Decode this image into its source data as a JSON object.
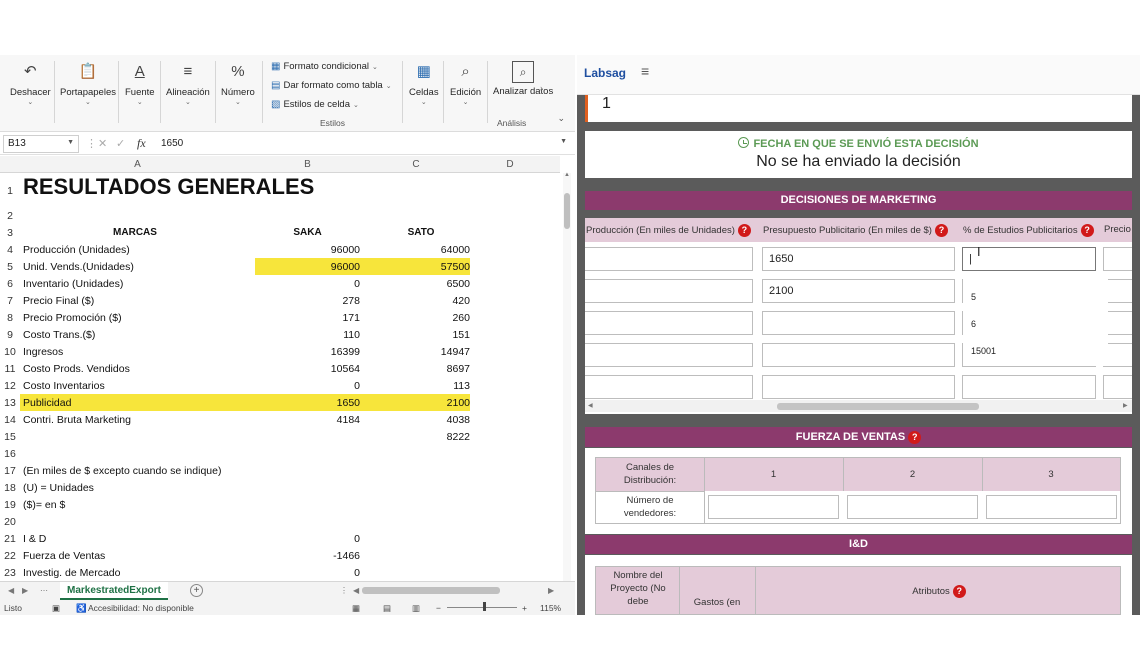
{
  "excel": {
    "ribbon": {
      "undo": "Deshacer",
      "clipboard": "Portapapeles",
      "font": "Fuente",
      "alignment": "Alineación",
      "number": "Número",
      "conditional_format": "Formato condicional",
      "format_as_table": "Dar formato como tabla",
      "cell_styles": "Estilos de celda",
      "styles_group": "Estilos",
      "cells": "Celdas",
      "editing": "Edición",
      "analyze_data": "Analizar datos",
      "analysis_group": "Análisis"
    },
    "formula_bar": {
      "name_box": "B13",
      "fx": "fx",
      "value": "1650"
    },
    "columns": [
      "A",
      "B",
      "C",
      "D"
    ],
    "rows": [
      {
        "n": "1",
        "a": "RESULTADOS GENERALES",
        "b": "",
        "c": ""
      },
      {
        "n": "2",
        "a": "",
        "b": "",
        "c": ""
      },
      {
        "n": "3",
        "a": "MARCAS",
        "b": "SAKA",
        "c": "SATO"
      },
      {
        "n": "4",
        "a": "Producción (Unidades)",
        "b": "96000",
        "c": "64000"
      },
      {
        "n": "5",
        "a": "Unid. Vends.(Unidades)",
        "b": "96000",
        "c": "57500"
      },
      {
        "n": "6",
        "a": "Inventario (Unidades)",
        "b": "0",
        "c": "6500"
      },
      {
        "n": "7",
        "a": "Precio Final ($)",
        "b": "278",
        "c": "420"
      },
      {
        "n": "8",
        "a": "Precio Promoción ($)",
        "b": "171",
        "c": "260"
      },
      {
        "n": "9",
        "a": "Costo Trans.($)",
        "b": "110",
        "c": "151"
      },
      {
        "n": "10",
        "a": "Ingresos",
        "b": "16399",
        "c": "14947"
      },
      {
        "n": "11",
        "a": "Costo Prods. Vendidos",
        "b": "10564",
        "c": "8697"
      },
      {
        "n": "12",
        "a": "Costo Inventarios",
        "b": "0",
        "c": "113"
      },
      {
        "n": "13",
        "a": "Publicidad",
        "b": "1650",
        "c": "2100"
      },
      {
        "n": "14",
        "a": "Contri. Bruta Marketing",
        "b": "4184",
        "c": "4038"
      },
      {
        "n": "15",
        "a": "",
        "b": "",
        "c": "8222"
      },
      {
        "n": "16",
        "a": "",
        "b": "",
        "c": ""
      },
      {
        "n": "17",
        "a": "(En miles de $ excepto cuando se indique)",
        "b": "",
        "c": ""
      },
      {
        "n": "18",
        "a": "(U) = Unidades",
        "b": "",
        "c": ""
      },
      {
        "n": "19",
        "a": "($)= en $",
        "b": "",
        "c": ""
      },
      {
        "n": "20",
        "a": "",
        "b": "",
        "c": ""
      },
      {
        "n": "21",
        "a": "I & D",
        "b": "0",
        "c": ""
      },
      {
        "n": "22",
        "a": "Fuerza de Ventas",
        "b": "-1466",
        "c": ""
      },
      {
        "n": "23",
        "a": "Investig. de Mercado",
        "b": "0",
        "c": ""
      }
    ],
    "sheet_tab": "MarkestratedExport",
    "status": {
      "ready": "Listo",
      "accessibility": "Accesibilidad: No disponible",
      "zoom": "115%"
    },
    "highlight_color": "#f7e53b"
  },
  "labsag": {
    "brand": "Labsag",
    "period_value": "1",
    "date_label": "FECHA EN QUE SE ENVIÓ ESTA DECISIÓN",
    "date_value": "No se ha enviado la decisión",
    "marketing": {
      "title": "DECISIONES DE MARKETING",
      "headers": [
        "Producción (En miles de Unidades)",
        "Presupuesto Publicitario (En miles de $)",
        "% de Estudios Publicitarios",
        "Precio"
      ],
      "budget_values": [
        "1650",
        "2100"
      ],
      "dropdown_options": [
        "5",
        "6",
        "15001"
      ]
    },
    "sales_force": {
      "title": "FUERZA DE VENTAS",
      "channels_label": "Canales de Distribución:",
      "channels": [
        "1",
        "2",
        "3"
      ],
      "sellers_label": "Número de vendedores:"
    },
    "rnd": {
      "title": "I&D",
      "project_name": "Nombre del Proyecto (No debe",
      "spend": "Gastos (en",
      "attributes": "Atributos"
    },
    "accent_color": "#8c3a6d",
    "help_color": "#d11a1a"
  }
}
